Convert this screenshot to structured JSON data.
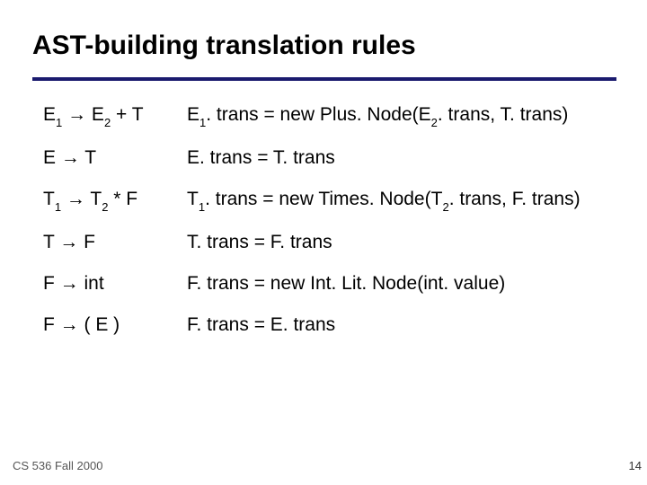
{
  "title": "AST-building translation rules",
  "rules": [
    {
      "lhs": [
        {
          "t": "E"
        },
        {
          "t": "1",
          "sub": true
        },
        {
          "t": " → E"
        },
        {
          "t": "2",
          "sub": true
        },
        {
          "t": " + T"
        }
      ],
      "rhs": [
        {
          "t": "E"
        },
        {
          "t": "1",
          "sub": true
        },
        {
          "t": ". trans = new Plus. Node(E"
        },
        {
          "t": "2",
          "sub": true
        },
        {
          "t": ". trans, T. trans)"
        }
      ]
    },
    {
      "lhs": [
        {
          "t": "E → T"
        }
      ],
      "rhs": [
        {
          "t": "E. trans = T. trans"
        }
      ]
    },
    {
      "lhs": [
        {
          "t": "T"
        },
        {
          "t": "1",
          "sub": true
        },
        {
          "t": " → T"
        },
        {
          "t": "2",
          "sub": true
        },
        {
          "t": " * F"
        }
      ],
      "rhs": [
        {
          "t": "T"
        },
        {
          "t": "1",
          "sub": true
        },
        {
          "t": ". trans = new Times. Node(T"
        },
        {
          "t": "2",
          "sub": true
        },
        {
          "t": ". trans, F. trans)"
        }
      ]
    },
    {
      "lhs": [
        {
          "t": "T → F"
        }
      ],
      "rhs": [
        {
          "t": "T. trans = F. trans"
        }
      ]
    },
    {
      "lhs": [
        {
          "t": "F → int"
        }
      ],
      "rhs": [
        {
          "t": "F. trans = new Int. Lit. Node(int. value)"
        }
      ]
    },
    {
      "lhs": [
        {
          "t": "F → ( E )"
        }
      ],
      "rhs": [
        {
          "t": "F. trans = E. trans"
        }
      ]
    }
  ],
  "footer_left": "CS 536  Fall 2000",
  "footer_right": "14"
}
